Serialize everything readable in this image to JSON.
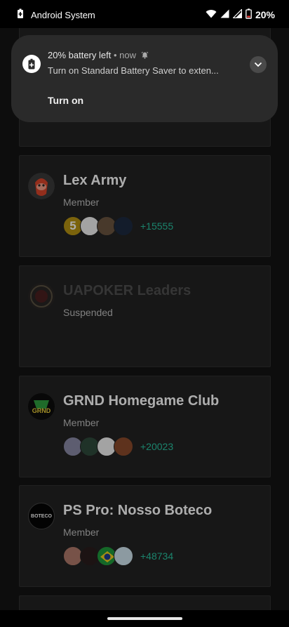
{
  "status_bar": {
    "app_label": "Android System",
    "battery_percent": "20%"
  },
  "notification": {
    "title": "20% battery left",
    "time": "now",
    "message": "Turn on Standard Battery Saver to exten...",
    "action": "Turn on"
  },
  "clubs": [
    {
      "name": "Lex Army",
      "role": "Member",
      "member_count": "+15555"
    },
    {
      "name": "UAPOKER Leaders",
      "role": "Suspended"
    },
    {
      "name": "GRND Homegame Club",
      "role": "Member",
      "member_count": "+20023",
      "logo_text": "GRND"
    },
    {
      "name": "PS Pro: Nosso Boteco",
      "role": "Member",
      "member_count": "+48734",
      "logo_text": "BOTECO"
    }
  ],
  "avatar_badge": "5",
  "colors": {
    "accent_count": "#28c2a0",
    "card_bg": "#232323"
  }
}
